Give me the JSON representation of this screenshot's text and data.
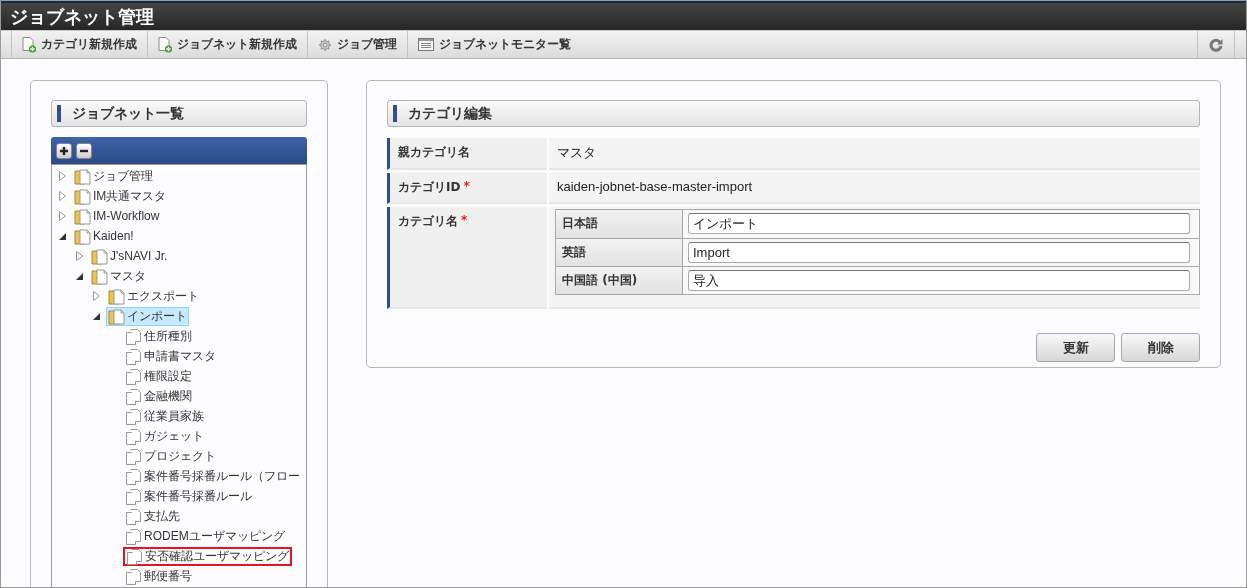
{
  "header": {
    "title": "ジョブネット管理"
  },
  "toolbar": {
    "buttons": [
      {
        "label": "カテゴリ新規作成",
        "kind": "new-doc"
      },
      {
        "label": "ジョブネット新規作成",
        "kind": "new-doc"
      },
      {
        "label": "ジョブ管理",
        "kind": "gear"
      },
      {
        "label": "ジョブネットモニター覧",
        "kind": "list"
      }
    ]
  },
  "tree_panel": {
    "title": "ジョブネット一覧",
    "tree": [
      {
        "label": "ジョブ管理",
        "kind": "folder",
        "expanded": false,
        "selected": false,
        "highlighted": false
      },
      {
        "label": "IM共通マスタ",
        "kind": "folder",
        "expanded": false,
        "selected": false,
        "highlighted": false
      },
      {
        "label": "IM-Workflow",
        "kind": "folder",
        "expanded": false,
        "selected": false,
        "highlighted": false
      },
      {
        "label": "Kaiden!",
        "kind": "folder",
        "expanded": true,
        "selected": false,
        "highlighted": false,
        "children": [
          {
            "label": "J'sNAVI Jr.",
            "kind": "folder",
            "expanded": false,
            "selected": false,
            "highlighted": false
          },
          {
            "label": "マスタ",
            "kind": "folder",
            "expanded": true,
            "selected": false,
            "highlighted": false,
            "children": [
              {
                "label": "エクスポート",
                "kind": "folder",
                "expanded": false,
                "selected": false,
                "highlighted": false
              },
              {
                "label": "インポート",
                "kind": "folder",
                "expanded": true,
                "selected": true,
                "highlighted": false,
                "children": [
                  {
                    "label": "住所種別",
                    "kind": "file",
                    "selected": false,
                    "highlighted": false
                  },
                  {
                    "label": "申請書マスタ",
                    "kind": "file",
                    "selected": false,
                    "highlighted": false
                  },
                  {
                    "label": "権限設定",
                    "kind": "file",
                    "selected": false,
                    "highlighted": false
                  },
                  {
                    "label": "金融機関",
                    "kind": "file",
                    "selected": false,
                    "highlighted": false
                  },
                  {
                    "label": "従業員家族",
                    "kind": "file",
                    "selected": false,
                    "highlighted": false
                  },
                  {
                    "label": "ガジェット",
                    "kind": "file",
                    "selected": false,
                    "highlighted": false
                  },
                  {
                    "label": "プロジェクト",
                    "kind": "file",
                    "selected": false,
                    "highlighted": false
                  },
                  {
                    "label": "案件番号採番ルール（フロー",
                    "kind": "file",
                    "selected": false,
                    "highlighted": false
                  },
                  {
                    "label": "案件番号採番ルール",
                    "kind": "file",
                    "selected": false,
                    "highlighted": false
                  },
                  {
                    "label": "支払先",
                    "kind": "file",
                    "selected": false,
                    "highlighted": false
                  },
                  {
                    "label": "RODEMユーザマッピング",
                    "kind": "file",
                    "selected": false,
                    "highlighted": false
                  },
                  {
                    "label": "安否確認ユーザマッピング",
                    "kind": "file",
                    "selected": false,
                    "highlighted": true
                  },
                  {
                    "label": "郵便番号",
                    "kind": "file",
                    "selected": false,
                    "highlighted": false
                  }
                ]
              }
            ]
          }
        ]
      }
    ]
  },
  "edit_panel": {
    "title": "カテゴリ編集",
    "fields": [
      {
        "label": "親カテゴリ名",
        "kind": "text",
        "value": "マスタ"
      },
      {
        "label": "カテゴリID",
        "mark": "*",
        "kind": "text",
        "value": "kaiden-jobnet-base-master-import"
      },
      {
        "label": "カテゴリ名",
        "mark": "*",
        "kind": "locales",
        "locales": [
          {
            "label": "日本語",
            "value": "インポート"
          },
          {
            "label": "英語",
            "value": "Import"
          },
          {
            "label": "中国語 (中国)",
            "value": "导入"
          }
        ]
      }
    ],
    "buttons": [
      "更新",
      "削除"
    ]
  }
}
